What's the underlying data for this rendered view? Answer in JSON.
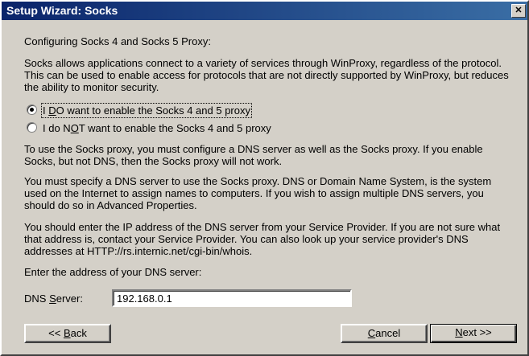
{
  "window": {
    "title": "Setup Wizard: Socks",
    "close_glyph": "✕"
  },
  "content": {
    "heading": "Configuring Socks 4 and Socks 5 Proxy:",
    "intro": "Socks allows applications connect to a variety of services through WinProxy, regardless of the protocol.  This can be used to enable access for protocols that are not directly supported by WinProxy, but reduces the ability to monitor security.",
    "radio_enable": {
      "prefix": "I ",
      "underline": "D",
      "rest": "O want to enable the Socks 4 and 5 proxy",
      "checked": true
    },
    "radio_disable": {
      "prefix": "I do N",
      "underline": "O",
      "rest": "T want to enable the Socks 4 and 5 proxy",
      "checked": false
    },
    "para_dns_required": "To use the Socks proxy, you must configure a DNS server as well as the Socks proxy.  If you enable Socks, but not DNS, then the Socks proxy will not work.",
    "para_dns_explained": "You must specify a DNS server to use the Socks proxy.  DNS or Domain Name System, is the system used on the Internet to assign names to computers.  If you wish to assign multiple DNS servers, you should do so in Advanced Properties.",
    "para_dns_provider": "You should enter the IP address of the DNS server from your Service Provider.  If you are not sure what that address is, contact your Service Provider.  You can also look up your service provider's DNS addresses at HTTP://rs.internic.net/cgi-bin/whois.",
    "enter_prompt": "Enter the address of your DNS server:",
    "dns_label": {
      "prefix": "DNS ",
      "underline": "S",
      "rest": "erver:"
    },
    "dns_value": "192.168.0.1"
  },
  "buttons": {
    "back": {
      "prefix": "<< ",
      "underline": "B",
      "rest": "ack"
    },
    "cancel": {
      "prefix": "",
      "underline": "C",
      "rest": "ancel"
    },
    "next": {
      "prefix": "",
      "underline": "N",
      "rest": "ext >>"
    }
  }
}
